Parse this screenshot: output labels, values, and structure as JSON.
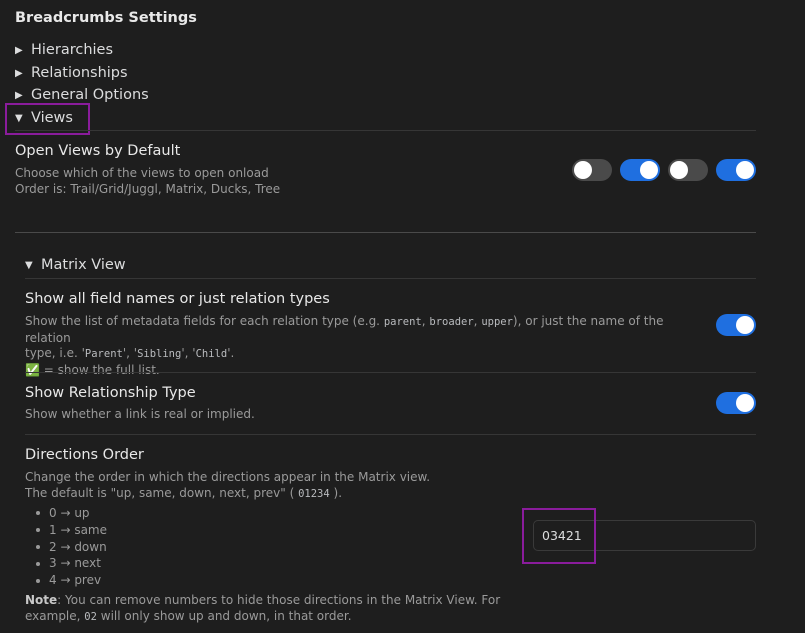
{
  "page_title": "Breadcrumbs Settings",
  "tree": {
    "hierarchies": "Hierarchies",
    "relationships": "Relationships",
    "general_options": "General Options",
    "views": "Views",
    "collapsed_glyph": "▶",
    "expanded_glyph": "▼"
  },
  "open_views": {
    "name": "Open Views by Default",
    "desc_line1": "Choose which of the views to open onload",
    "desc_line2": "Order is: Trail/Grid/Juggl, Matrix, Ducks, Tree",
    "toggles": [
      false,
      true,
      false,
      true
    ]
  },
  "matrix_view": {
    "heading": "Matrix View",
    "field_names": {
      "name": "Show all field names or just relation types",
      "desc_a": "Show the list of metadata fields for each relation type (e.g.",
      "codes": [
        "parent",
        "broader",
        "upper"
      ],
      "desc_b": "), or just the name of the relation",
      "desc_c": "type, i.e. '",
      "types": [
        "Parent",
        "Sibling",
        "Child"
      ],
      "sep": "', '",
      "desc_d": "'.",
      "desc_line3": "✅ = show the full list.",
      "toggle": true
    },
    "rel_type": {
      "name": "Show Relationship Type",
      "desc": "Show whether a link is real or implied.",
      "toggle": true
    },
    "directions": {
      "name": "Directions Order",
      "desc_line1": "Change the order in which the directions appear in the Matrix view.",
      "desc_line2_a": "The default is \"up, same, down, next, prev\" (",
      "default_code": "01234",
      "desc_line2_b": ").",
      "items": [
        "0 → up",
        "1 → same",
        "2 → down",
        "3 → next",
        "4 → prev"
      ],
      "note_label": "Note",
      "note_a": ": You can remove numbers to hide those directions in the Matrix View. For",
      "note_b": "example,",
      "note_code": "02",
      "note_c": "will only show up and down, in that order.",
      "value": "03421"
    }
  },
  "colors": {
    "background": "#1e1e1e",
    "toggle_on": "#1f6fe0",
    "toggle_off": "#4a4a4a",
    "highlight": "#8a1c9c"
  }
}
